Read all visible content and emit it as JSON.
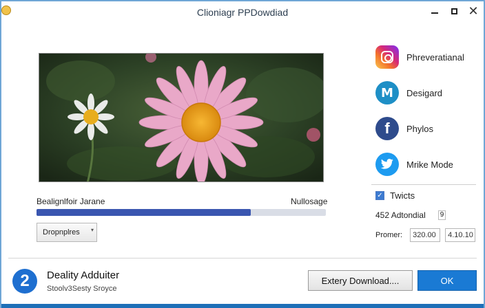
{
  "window": {
    "title": "Clioniagr PPDowdiad"
  },
  "preview": {
    "image_description_icon": "flower-photo"
  },
  "progress": {
    "label_left": "Bealignlfoir Jarane",
    "label_right": "Nullosage",
    "fraction": 0.74
  },
  "dropdown": {
    "value": "Dropnplres"
  },
  "social": {
    "items": [
      {
        "icon": "instagram-icon",
        "label": "Phreveratianal"
      },
      {
        "icon": "m-icon",
        "label": "Desigard"
      },
      {
        "icon": "facebook-icon",
        "label": "Phylos"
      },
      {
        "icon": "twitter-icon",
        "label": "Mrike Mode"
      }
    ]
  },
  "options": {
    "check_label": "Twicts",
    "count_label": "452 Adtondial",
    "count_badge": "9",
    "promer_label": "Promer:",
    "field1": "320.00",
    "field2": "4.10.10"
  },
  "footer": {
    "badge": "2",
    "title": "Deality Adduiter",
    "subtitle": "Stoolv3Sesty Sroyce",
    "secondary_button": "Extery Download....",
    "primary_button": "OK"
  },
  "colors": {
    "accent": "#1a7ad4",
    "progress": "#3a56b0"
  }
}
